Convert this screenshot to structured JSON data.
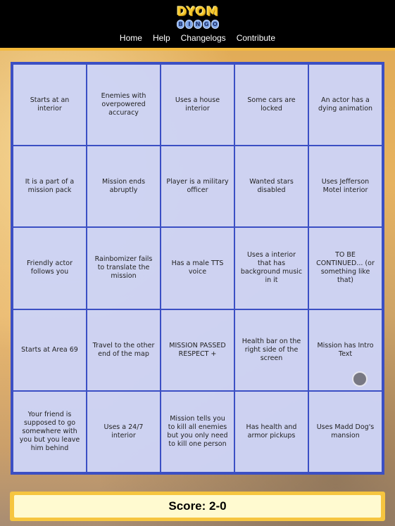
{
  "site": {
    "logo_top": "DYOM",
    "logo_bottom": [
      "B",
      "I",
      "N",
      "G",
      "O"
    ]
  },
  "nav": {
    "items": [
      "Home",
      "Help",
      "Changelogs",
      "Contribute"
    ]
  },
  "board": {
    "cells": [
      [
        "Starts at an interior",
        "Enemies with overpowered accuracy",
        "Uses a house interior",
        "Some cars are locked",
        "An actor has a dying animation"
      ],
      [
        "It is a part of a mission pack",
        "Mission ends abruptly",
        "Player is a military officer",
        "Wanted stars disabled",
        "Uses Jefferson Motel interior"
      ],
      [
        "Friendly actor follows you",
        "Rainbomizer fails to translate the mission",
        "Has a male TTS voice",
        "Uses a interior that has background music in it",
        "TO BE CONTINUED... (or something like that)"
      ],
      [
        "Starts at Area 69",
        "Travel to the other end of the map",
        "MISSION PASSED RESPECT +",
        "Health bar on the right side of the screen",
        "Mission has Intro Text"
      ],
      [
        "Your friend is supposed to go somewhere with you but you leave him behind",
        "Uses a 24/7 interior",
        "Mission tells you to kill all enemies but you only need to kill one person",
        "Has health and armor pickups",
        "Uses Madd Dog's mansion"
      ]
    ]
  },
  "score": {
    "text": "Score: 2-0"
  },
  "colors": {
    "header_bg": "#000000",
    "accent": "#f4b93a",
    "grid_border": "#3b4fc4",
    "cell_bg": "#cdd2f5",
    "score_bg": "#fffad0"
  }
}
